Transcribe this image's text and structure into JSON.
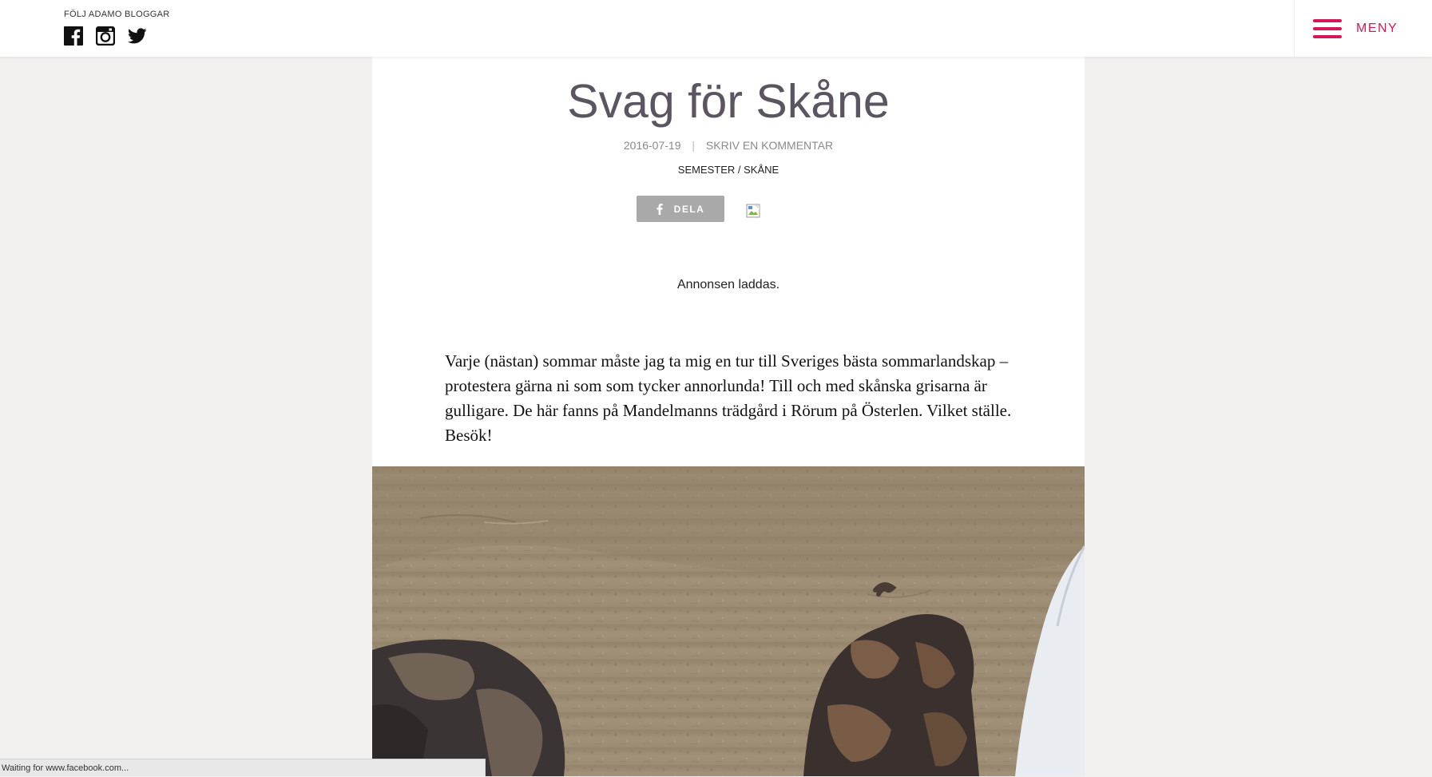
{
  "header": {
    "follow_label": "FÖLJ ADAMO BLOGGAR",
    "social": [
      {
        "icon": "facebook-icon"
      },
      {
        "icon": "instagram-icon"
      },
      {
        "icon": "twitter-icon"
      }
    ],
    "menu_label": "MENY",
    "accent_color": "#d3175a"
  },
  "article": {
    "title": "Svag för Skåne",
    "date": "2016-07-19",
    "meta_separator": "|",
    "comment_link": "SKRIV EN KOMMENTAR",
    "categories": "SEMESTER / SKÅNE",
    "share_label": "DELA",
    "ad_loading": "Annonsen laddas.",
    "body": "Varje (nästan) sommar måste jag ta mig en tur till Sveriges bästa sommarlandskap – protestera gärna ni som som tycker annorlunda! Till och med skånska grisarna är gulligare. De här fanns på Mandelmanns trädgård i Rörum på Österlen. Vilket ställe. Besök!"
  },
  "statusbar": {
    "text": "Waiting for www.facebook.com..."
  }
}
